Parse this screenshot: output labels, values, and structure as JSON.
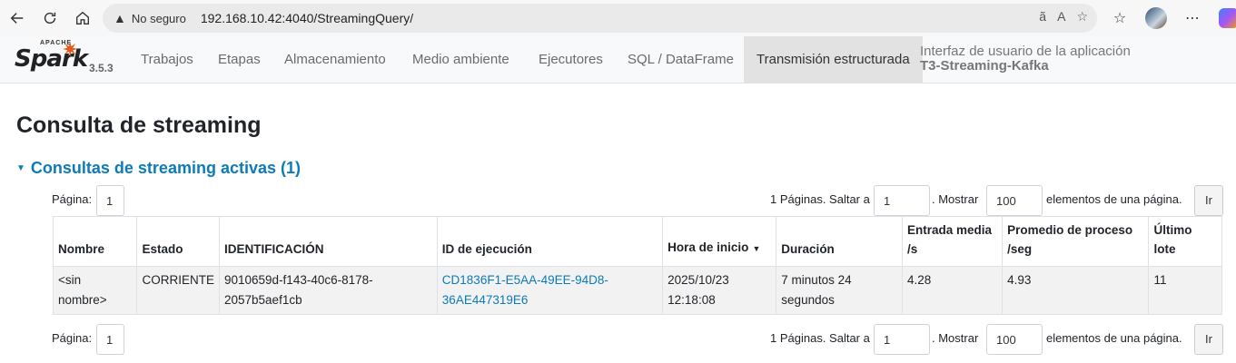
{
  "browser": {
    "security_label": "No seguro",
    "url": "192.168.10.42:4040/StreamingQuery/"
  },
  "spark": {
    "brand_apache": "APACHE",
    "brand_spark": "Spark",
    "version": "3.5.3",
    "tabs": [
      {
        "label": "Trabajos"
      },
      {
        "label": "Etapas"
      },
      {
        "label": "Almacenamiento"
      },
      {
        "label": "Medio ambiente"
      },
      {
        "label": "Ejecutores"
      },
      {
        "label": "SQL / DataFrame"
      },
      {
        "label": "Transmisión estructurada"
      }
    ],
    "app_ui_label": "Interfaz de usuario de la aplicación",
    "app_name": "T3-Streaming-Kafka"
  },
  "page": {
    "title": "Consulta de streaming",
    "section_title": "Consultas de streaming activas (1)"
  },
  "pager": {
    "page_label": "Página:",
    "page_value": "1",
    "pages_text": "1 Páginas. Saltar a",
    "jump_value": "1",
    "show_text": ". Mostrar",
    "size_value": "100",
    "per_page_text": "elementos de una página.",
    "go_label": "Ir"
  },
  "table": {
    "headers": [
      "Nombre",
      "Estado",
      "IDENTIFICACIÓN",
      "ID de ejecución",
      "Hora de inicio",
      "Duración",
      "Entrada media /s",
      "Promedio de proceso /seg",
      "Último lote"
    ],
    "sort_indicator": "▼",
    "rows": [
      {
        "nombre": "<sin nombre>",
        "estado": "CORRIENTE",
        "id": "9010659d-f143-40c6-8178-2057b5aef1cb",
        "run_id": "CD1836F1-E5AA-49EE-94D8-36AE447319E6",
        "inicio": "2025/10/23 12:18:08",
        "duracion": "7 minutos 24 segundos",
        "entrada": "4.28",
        "proceso": "4.93",
        "lote": "11"
      }
    ]
  }
}
